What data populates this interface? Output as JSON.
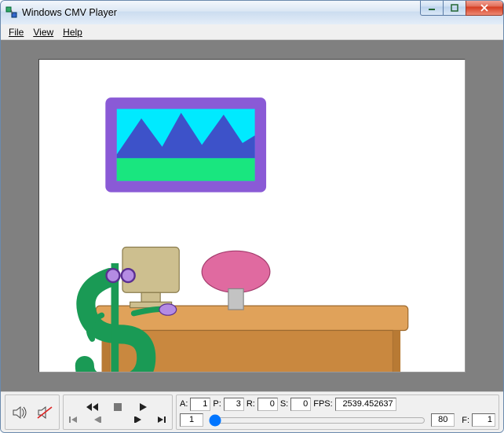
{
  "window": {
    "title": "Windows CMV Player"
  },
  "menu": {
    "file": "File",
    "view": "View",
    "help": "Help"
  },
  "status": {
    "A_label": "A:",
    "A_value": "1",
    "P_label": "P:",
    "P_value": "3",
    "R_label": "R:",
    "R_value": "0",
    "S_label": "S:",
    "S_value": "0",
    "FPS_label": "FPS:",
    "FPS_value": "2539.452637",
    "frame_start": "1",
    "frame_end": "80",
    "F_label": "F:",
    "F_value": "1"
  }
}
